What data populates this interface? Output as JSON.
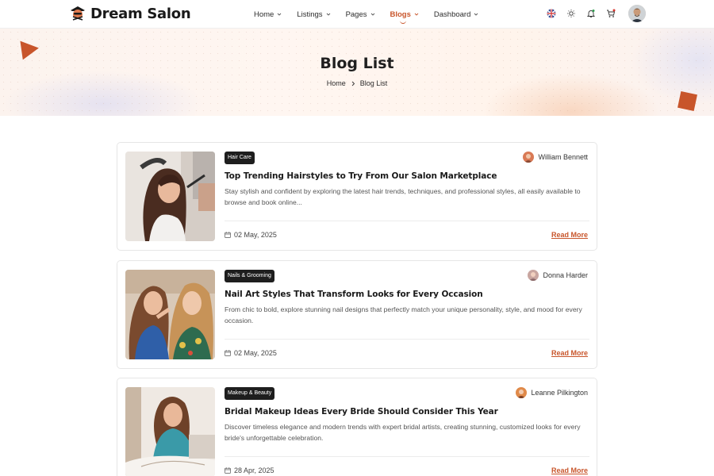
{
  "header": {
    "logo_text": "Dream Salon",
    "nav": [
      {
        "label": "Home",
        "active": false
      },
      {
        "label": "Listings",
        "active": false
      },
      {
        "label": "Pages",
        "active": false
      },
      {
        "label": "Blogs",
        "active": true
      },
      {
        "label": "Dashboard",
        "active": false
      }
    ],
    "icons": [
      "flag-uk-icon",
      "sun-icon",
      "bell-icon",
      "cart-icon"
    ],
    "accent_color": "#c8552b"
  },
  "banner": {
    "title": "Blog List",
    "breadcrumb": {
      "home": "Home",
      "current": "Blog List"
    }
  },
  "posts": [
    {
      "category": "Hair Care",
      "author": "William Bennett",
      "title": "Top Trending Hairstyles to Try From Our Salon Marketplace",
      "description": "Stay stylish and confident by exploring the latest hair trends, techniques, and professional styles, all easily available to browse and book online...",
      "date": "02 May, 2025",
      "read_more": "Read More"
    },
    {
      "category": "Nails & Grooming",
      "author": "Donna Harder",
      "title": "Nail Art Styles That Transform Looks for Every Occasion",
      "description": "From chic to bold, explore stunning nail designs that perfectly match your unique personality, style, and mood for every occasion.",
      "date": "02 May, 2025",
      "read_more": "Read More"
    },
    {
      "category": "Makeup & Beauty",
      "author": "Leanne Pilkington",
      "title": "Bridal Makeup Ideas Every Bride Should Consider This Year",
      "description": "Discover timeless elegance and modern trends with expert bridal artists, creating stunning, customized looks for every bride's unforgettable celebration.",
      "date": "28 Apr, 2025",
      "read_more": "Read More"
    }
  ]
}
